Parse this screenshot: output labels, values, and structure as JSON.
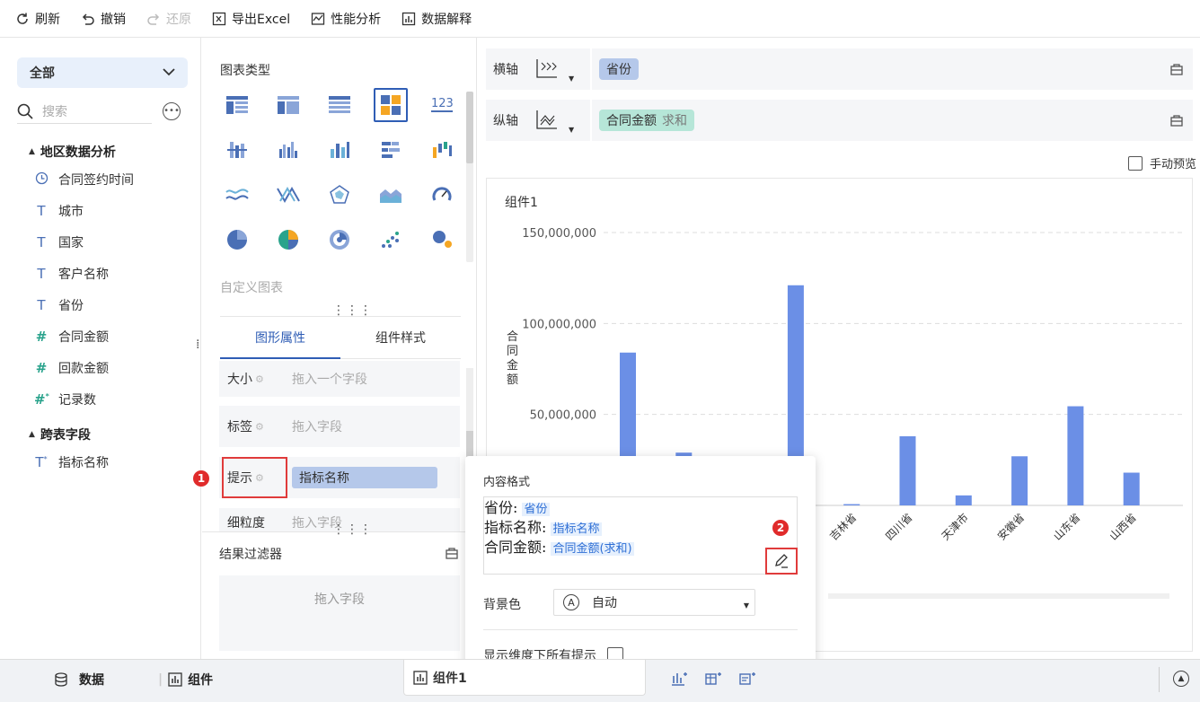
{
  "toolbar": {
    "refresh": "刷新",
    "undo": "撤销",
    "redo": "还原",
    "export_excel": "导出Excel",
    "perf_analysis": "性能分析",
    "data_explain": "数据解释"
  },
  "left_panel": {
    "dataset_select": "全部",
    "search_placeholder": "搜索",
    "groups": [
      {
        "title": "地区数据分析",
        "fields": [
          {
            "label": "合同签约时间",
            "icon": "clock-icon"
          },
          {
            "label": "城市",
            "icon": "text-type-icon"
          },
          {
            "label": "国家",
            "icon": "text-type-icon"
          },
          {
            "label": "客户名称",
            "icon": "text-type-icon"
          },
          {
            "label": "省份",
            "icon": "text-type-icon"
          },
          {
            "label": "合同金额",
            "icon": "hash-icon"
          },
          {
            "label": "回款金额",
            "icon": "hash-icon"
          },
          {
            "label": "记录数",
            "icon": "hash-star-icon"
          }
        ]
      },
      {
        "title": "跨表字段",
        "fields": [
          {
            "label": "指标名称",
            "icon": "text-star-icon"
          }
        ]
      }
    ]
  },
  "middle_panel": {
    "chart_type_title": "图表类型",
    "custom_chart": "自定义图表",
    "tabs": [
      "图形属性",
      "组件样式"
    ],
    "props": [
      {
        "label": "大小",
        "value": "拖入一个字段"
      },
      {
        "label": "标签",
        "value": "拖入字段"
      },
      {
        "label": "提示",
        "value": "指标名称"
      },
      {
        "label": "细粒度",
        "value": "拖入字段"
      }
    ],
    "badge1": "1",
    "filter_title": "结果过滤器",
    "filter_drop": "拖入字段"
  },
  "right_panel": {
    "x_axis_label": "横轴",
    "x_axis_field": "省份",
    "y_axis_label": "纵轴",
    "y_axis_field": "合同金额",
    "y_axis_agg": "求和",
    "manual_preview": "手动预览",
    "chart_title": "组件1",
    "y_axis_title": "合同金额"
  },
  "chart_data": {
    "type": "bar",
    "categories": [
      "",
      "",
      "",
      "",
      "吉林省",
      "四川省",
      "天津市",
      "安徽省",
      "山东省",
      "山西省"
    ],
    "values": [
      84000000,
      29000000,
      0,
      121000000,
      700000,
      38000000,
      5500000,
      27000000,
      54500000,
      18000000
    ],
    "ylim": [
      0,
      150000000
    ],
    "yticks": [
      "50,000,000",
      "100,000,000",
      "150,000,000"
    ],
    "ytick_values": [
      50000000,
      100000000,
      150000000
    ],
    "bar_color": "#6b8fe6",
    "grid": "dashed horizontal"
  },
  "popup": {
    "title": "内容格式",
    "lines": [
      {
        "prefix": "省份: ",
        "token": "省份"
      },
      {
        "prefix": "指标名称: ",
        "token": "指标名称"
      },
      {
        "prefix": "合同金额: ",
        "token": "合同金额(求和)"
      }
    ],
    "badge2": "2",
    "bg_label": "背景色",
    "bg_value": "自动",
    "show_all_label": "显示维度下所有提示"
  },
  "bottom_bar": {
    "data": "数据",
    "component": "组件",
    "tab_name": "组件1"
  }
}
